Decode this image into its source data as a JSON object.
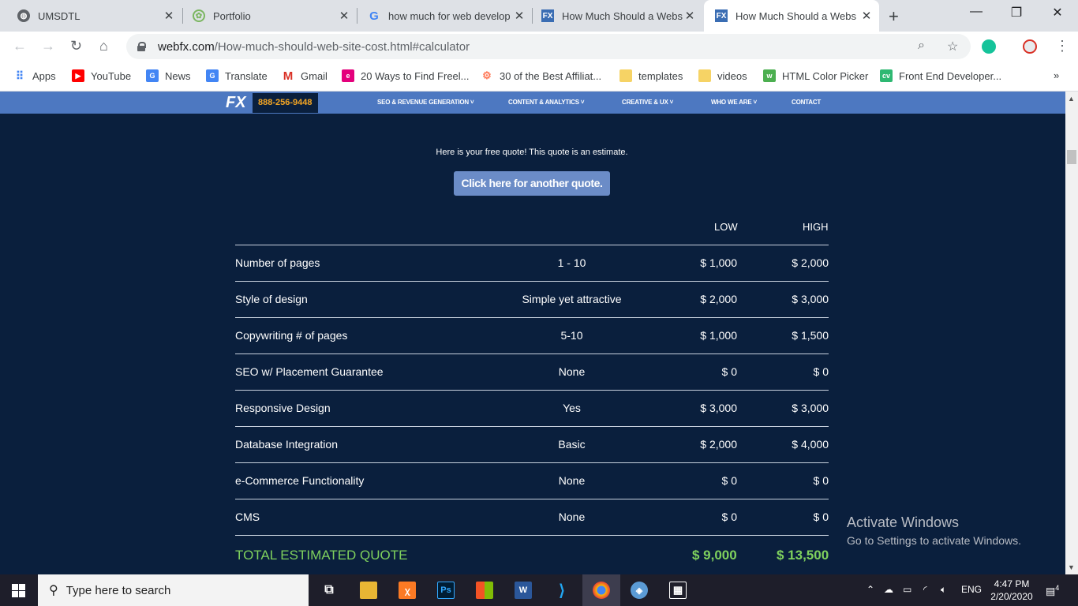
{
  "browser": {
    "tabs": [
      {
        "title": "UMSDTL",
        "favicon": "globe-icon",
        "active": false
      },
      {
        "title": "Portfolio",
        "favicon": "portfolio-icon",
        "active": false
      },
      {
        "title": "how much for web develop",
        "favicon": "google-icon",
        "active": false
      },
      {
        "title": "How Much Should a Webs",
        "favicon": "webfx-icon",
        "active": false
      },
      {
        "title": "How Much Should a Webs",
        "favicon": "webfx-icon",
        "active": true
      }
    ],
    "new_tab": "+",
    "url_host": "webfx.com",
    "url_path": "/How-much-should-web-site-cost.html#calculator",
    "bookmarks": [
      {
        "label": "Apps",
        "icon": "apps-grid-icon",
        "color": "#4285f4"
      },
      {
        "label": "YouTube",
        "icon": "youtube-icon",
        "color": "#ff0000"
      },
      {
        "label": "News",
        "icon": "google-news-icon",
        "color": "#4285f4"
      },
      {
        "label": "Translate",
        "icon": "google-translate-icon",
        "color": "#4285f4"
      },
      {
        "label": "Gmail",
        "icon": "gmail-icon",
        "color": "#d93025"
      },
      {
        "label": "20 Ways to Find Freel...",
        "icon": "e-icon",
        "color": "#e4007c"
      },
      {
        "label": "30 of the Best Affiliat...",
        "icon": "hubspot-icon",
        "color": "#ff7a59"
      },
      {
        "label": "templates",
        "icon": "folder-icon",
        "color": "#f6d365"
      },
      {
        "label": "videos",
        "icon": "folder-icon",
        "color": "#f6d365"
      },
      {
        "label": "HTML Color Picker",
        "icon": "w3schools-icon",
        "color": "#4caf50"
      },
      {
        "label": "Front End Developer...",
        "icon": "cv-icon",
        "color": "#2eb872"
      }
    ],
    "more_bookmarks": "»"
  },
  "site": {
    "logo": "FX",
    "phone": "888-256-9448",
    "nav": [
      "SEO & REVENUE GENERATION",
      "CONTENT & ANALYTICS",
      "CREATIVE & UX",
      "WHO WE ARE",
      "CONTACT"
    ],
    "intro": "Here is your free quote! This quote is an estimate.",
    "another_quote_button": "Click here for another quote.",
    "columns": {
      "low": "LOW",
      "high": "HIGH"
    },
    "rows": [
      {
        "label": "Number of pages",
        "selection": "1 - 10",
        "low": "$ 1,000",
        "high": "$ 2,000"
      },
      {
        "label": "Style of design",
        "selection": "Simple yet attractive",
        "low": "$ 2,000",
        "high": "$ 3,000"
      },
      {
        "label": "Copywriting # of pages",
        "selection": "5-10",
        "low": "$ 1,000",
        "high": "$ 1,500"
      },
      {
        "label": "SEO w/ Placement Guarantee",
        "selection": "None",
        "low": "$ 0",
        "high": "$ 0"
      },
      {
        "label": "Responsive Design",
        "selection": "Yes",
        "low": "$ 3,000",
        "high": "$ 3,000"
      },
      {
        "label": "Database Integration",
        "selection": "Basic",
        "low": "$ 2,000",
        "high": "$ 4,000"
      },
      {
        "label": "e-Commerce Functionality",
        "selection": "None",
        "low": "$ 0",
        "high": "$ 0"
      },
      {
        "label": "CMS",
        "selection": "None",
        "low": "$ 0",
        "high": "$ 0"
      }
    ],
    "total": {
      "label": "TOTAL ESTIMATED QUOTE",
      "low": "$ 9,000",
      "high": "$ 13,500"
    },
    "accent_total_color": "#7fd15d"
  },
  "watermark": {
    "line1": "Activate Windows",
    "line2": "Go to Settings to activate Windows."
  },
  "taskbar": {
    "search_placeholder": "Type here to search",
    "language": "ENG",
    "time": "4:47 PM",
    "date": "2/20/2020",
    "notification_count": "4"
  }
}
